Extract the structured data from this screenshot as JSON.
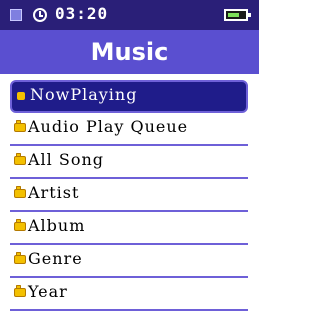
{
  "status_bar": {
    "time": "03:20",
    "battery_level": 0.7,
    "icons": [
      "status-indicator-icon",
      "clock-icon",
      "battery-icon"
    ]
  },
  "header": {
    "title": "Music"
  },
  "menu": {
    "selected_index": 0,
    "items": [
      {
        "label": "NowPlaying",
        "icon": "selected-dot-icon"
      },
      {
        "label": "Audio Play Queue",
        "icon": "folder-icon"
      },
      {
        "label": "All Song",
        "icon": "folder-icon"
      },
      {
        "label": "Artist",
        "icon": "folder-icon"
      },
      {
        "label": "Album",
        "icon": "folder-icon"
      },
      {
        "label": "Genre",
        "icon": "folder-icon"
      },
      {
        "label": "Year",
        "icon": "folder-icon"
      }
    ]
  },
  "colors": {
    "status_bar_bg": "#2a1f78",
    "title_bar_bg": "#5a4fd0",
    "selection_bg": "#1f1c8a",
    "divider": "#6e60d8",
    "folder": "#f3c000"
  }
}
